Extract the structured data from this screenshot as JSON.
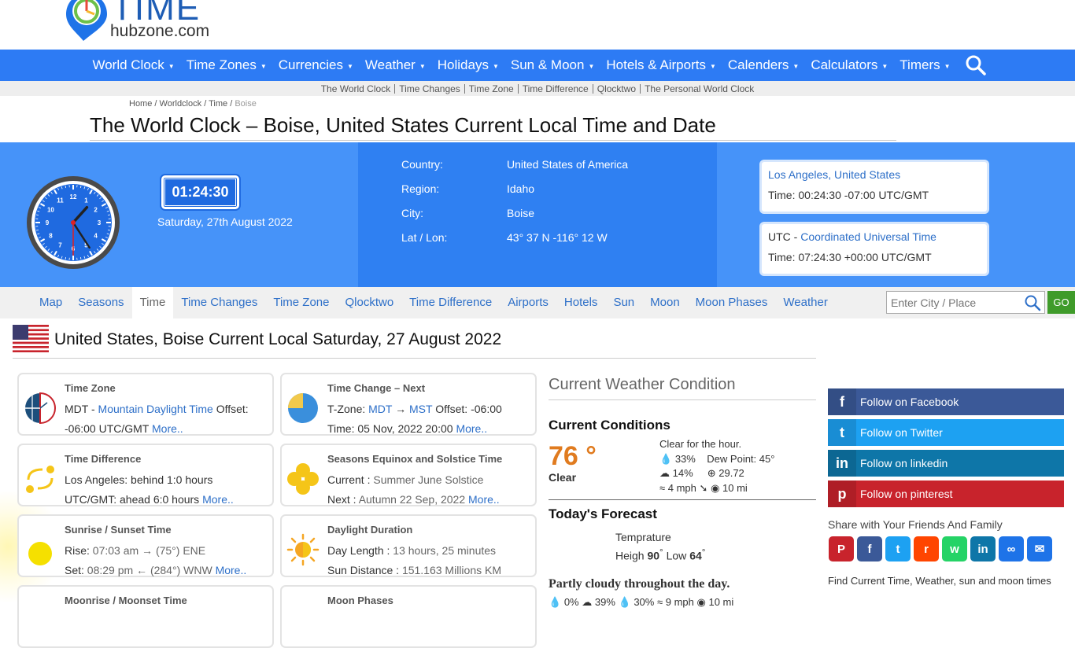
{
  "logo": {
    "title": "TIME",
    "subtitle": "hubzone.com"
  },
  "mainnav": [
    {
      "label": "World Clock"
    },
    {
      "label": "Time Zones"
    },
    {
      "label": "Currencies"
    },
    {
      "label": "Weather"
    },
    {
      "label": "Holidays"
    },
    {
      "label": "Sun & Moon"
    },
    {
      "label": "Hotels & Airports"
    },
    {
      "label": "Calenders"
    },
    {
      "label": "Calculators"
    },
    {
      "label": "Timers"
    }
  ],
  "subnav": [
    "The World Clock",
    "Time Changes",
    "Time Zone",
    "Time Difference",
    "Qlocktwo",
    "The Personal World Clock"
  ],
  "breadcrumb": {
    "home": "Home",
    "worldclock": "Worldclock",
    "time": "Time",
    "current": "Boise",
    "sep": "/"
  },
  "page_title": "The World Clock – Boise, United States Current Local Time and Date",
  "clock": {
    "digital": "01:24:30",
    "date": "Saturday, 27th August 2022",
    "face_color": "#1f6ae0",
    "hours": 1,
    "minutes": 24,
    "seconds": 30
  },
  "location": {
    "country_label": "Country:",
    "country": "United States of America",
    "region_label": "Region:",
    "region": "Idaho",
    "city_label": "City:",
    "city": "Boise",
    "latlon_label": "Lat / Lon:",
    "latlon": "43° 37 N -116° 12 W"
  },
  "compare": [
    {
      "prefix": "",
      "name": "Los Angeles, United States",
      "time": "Time: 00:24:30  -07:00 UTC/GMT"
    },
    {
      "prefix": "UTC - ",
      "name": "Coordinated Universal Time",
      "time": "Time: 07:24:30  +00:00 UTC/GMT"
    }
  ],
  "tabs": [
    "Map",
    "Seasons",
    "Time",
    "Time Changes",
    "Time Zone",
    "Qlocktwo",
    "Time Difference",
    "Airports",
    "Hotels",
    "Sun",
    "Moon",
    "Moon Phases",
    "Weather"
  ],
  "active_tab": "Time",
  "city_search": {
    "placeholder": "Enter City / Place",
    "go": "GO"
  },
  "section_title": "United States, Boise Current Local Saturday, 27 August 2022",
  "cards": {
    "timezone": {
      "title": "Time Zone",
      "abbr": "MDT",
      "sep": " - ",
      "name": "Mountain Daylight Time",
      "offset_label": " Offset:",
      "offset": "-06:00 UTC/GMT",
      "more": "More.."
    },
    "timechange": {
      "title": "Time Change – Next",
      "tz_label": "T-Zone: ",
      "from": "MDT",
      "arrow": " → ",
      "to": "MST",
      "offset_label": " Offset: ",
      "offset": "-06:00",
      "time": "Time: 05 Nov, 2022 20:00",
      "more": "More.."
    },
    "timediff": {
      "title": "Time Difference",
      "line1": "Los Angeles: behind 1:0 hours",
      "line2": "UTC/GMT: ahead 6:0 hours",
      "more": "More.."
    },
    "seasons": {
      "title": "Seasons Equinox and Solstice Time",
      "current_label": "Current : ",
      "current": "Summer June Solstice",
      "next_label": "Next : ",
      "next": "Autumn 22 Sep, 2022",
      "more": "More.."
    },
    "sunrise": {
      "title": "Sunrise / Sunset Time",
      "rise_label": "Rise: ",
      "rise": "07:03 am → (75°) ENE",
      "set_label": "Set: ",
      "set": "08:29 pm ← (284°) WNW",
      "more": "More.."
    },
    "daylight": {
      "title": "Daylight Duration",
      "len_label": "Day Length : ",
      "len": "13 hours, 25 minutes",
      "dist_label": "Sun Distance : ",
      "dist": "151.163 Millions KM"
    },
    "moonrise": {
      "title": "Moonrise / Moonset Time"
    },
    "moonphase": {
      "title": "Moon Phases"
    }
  },
  "weather": {
    "heading": "Current Weather Condition",
    "current_label": "Current Conditions",
    "temp": "76 °",
    "condition": "Clear",
    "summary": "Clear for the hour.",
    "humidity": "33%",
    "dew_point": "Dew Point: 45°",
    "cloud": "14%",
    "pressure": "29.72",
    "wind": "4 mph",
    "visibility": "10 mi",
    "forecast_label": "Today's Forecast",
    "temp_label": "Temprature",
    "high_label": "Heigh ",
    "high": "90",
    "low_label": " Low ",
    "low": "64",
    "degree": "°",
    "forecast_text": "Partly cloudy throughout the day.",
    "f_humidity": "0%",
    "f_cloud": "39%",
    "f_precip": "30%",
    "f_wind": "9 mph",
    "f_vis": "10 mi"
  },
  "social": [
    {
      "label": "Follow on Facebook",
      "icon": "f",
      "color": "#3b5998"
    },
    {
      "label": "Follow on Twitter",
      "icon": "t",
      "color": "#1da1f2"
    },
    {
      "label": "Follow on linkedin",
      "icon": "in",
      "color": "#0e76a8"
    },
    {
      "label": "Follow on pinterest",
      "icon": "p",
      "color": "#c8232c"
    }
  ],
  "share_text": "Share with Your Friends And Family",
  "share_icons": [
    {
      "name": "pinterest",
      "glyph": "P",
      "color": "#c8232c"
    },
    {
      "name": "facebook",
      "glyph": "f",
      "color": "#3b5998"
    },
    {
      "name": "twitter",
      "glyph": "t",
      "color": "#1da1f2"
    },
    {
      "name": "reddit",
      "glyph": "r",
      "color": "#ff4500"
    },
    {
      "name": "whatsapp",
      "glyph": "w",
      "color": "#25d366"
    },
    {
      "name": "linkedin",
      "glyph": "in",
      "color": "#0e76a8"
    },
    {
      "name": "copy-link",
      "glyph": "∞",
      "color": "#1e73e8"
    },
    {
      "name": "email",
      "glyph": "✉",
      "color": "#1e73e8"
    }
  ],
  "find_text": "Find Current Time, Weather, sun and moon times"
}
